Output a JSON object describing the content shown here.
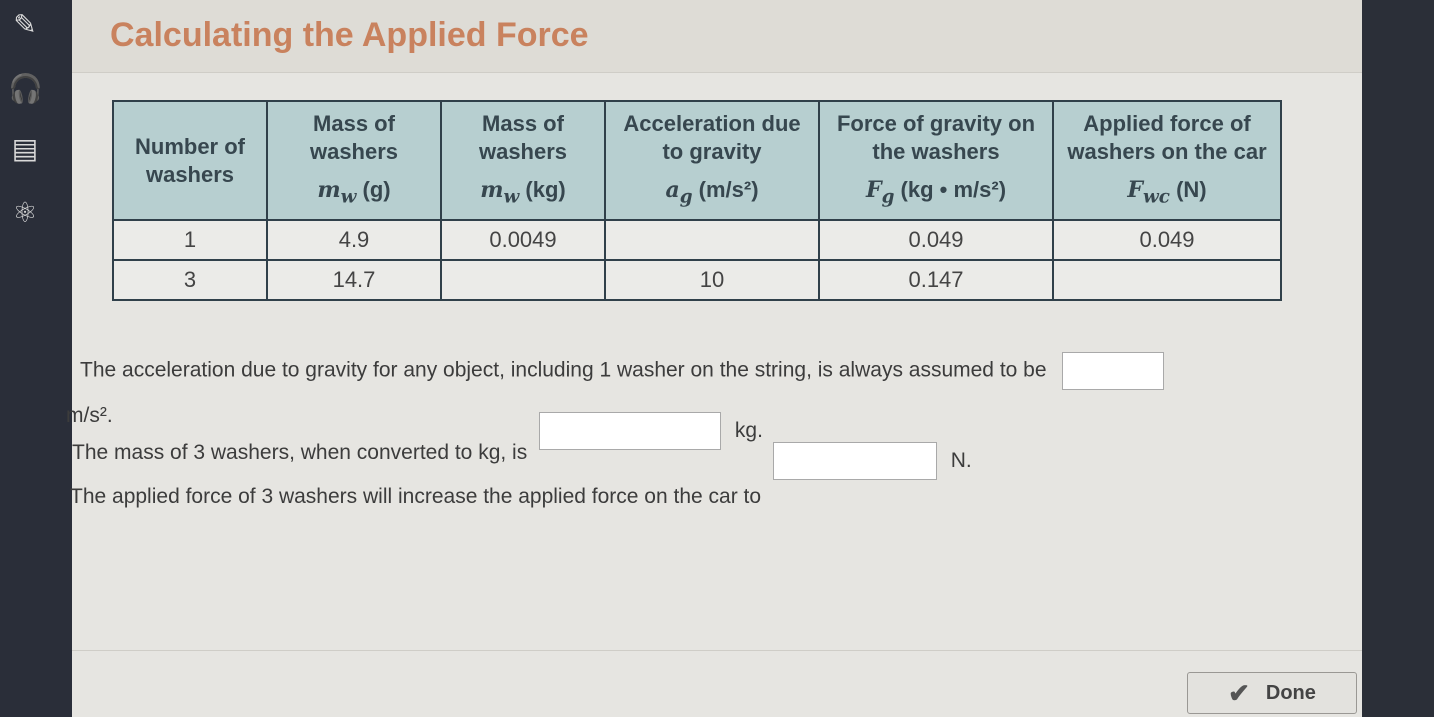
{
  "sidebar": {
    "icons": [
      "pencil-icon",
      "headphones-icon",
      "notes-icon",
      "atom-icon"
    ]
  },
  "header": {
    "title": "Calculating the Applied Force"
  },
  "table": {
    "headers": [
      {
        "line": "Number of washers",
        "unit": ""
      },
      {
        "line": "Mass of washers",
        "symbol": "m",
        "sub": "w",
        "unit": "(g)"
      },
      {
        "line": "Mass of washers",
        "symbol": "m",
        "sub": "w",
        "unit": "(kg)"
      },
      {
        "line": "Acceleration due to gravity",
        "symbol": "a",
        "sub": "g",
        "unit": "(m/s²)"
      },
      {
        "line": "Force of gravity on the washers",
        "symbol": "F",
        "sub": "g",
        "unit": "(kg • m/s²)"
      },
      {
        "line": "Applied force of washers on the car",
        "symbol": "F",
        "sub": "wc",
        "unit": "(N)"
      }
    ],
    "rows": [
      [
        "1",
        "4.9",
        "0.0049",
        "",
        "0.049",
        "0.049"
      ],
      [
        "3",
        "14.7",
        "",
        "10",
        "0.147",
        ""
      ]
    ]
  },
  "questions": {
    "q1_text": "The acceleration due to gravity for any object, including 1 washer on the string, is always assumed to be",
    "q1_unit": "m/s².",
    "q1_value": "",
    "q2_text": "The mass of 3 washers, when converted to kg, is",
    "q2_unit": "kg.",
    "q2_value": "",
    "q3_text": "The applied force of 3 washers will increase the applied force on the car to",
    "q3_unit": "N.",
    "q3_value": ""
  },
  "footer": {
    "done_label": "Done"
  }
}
